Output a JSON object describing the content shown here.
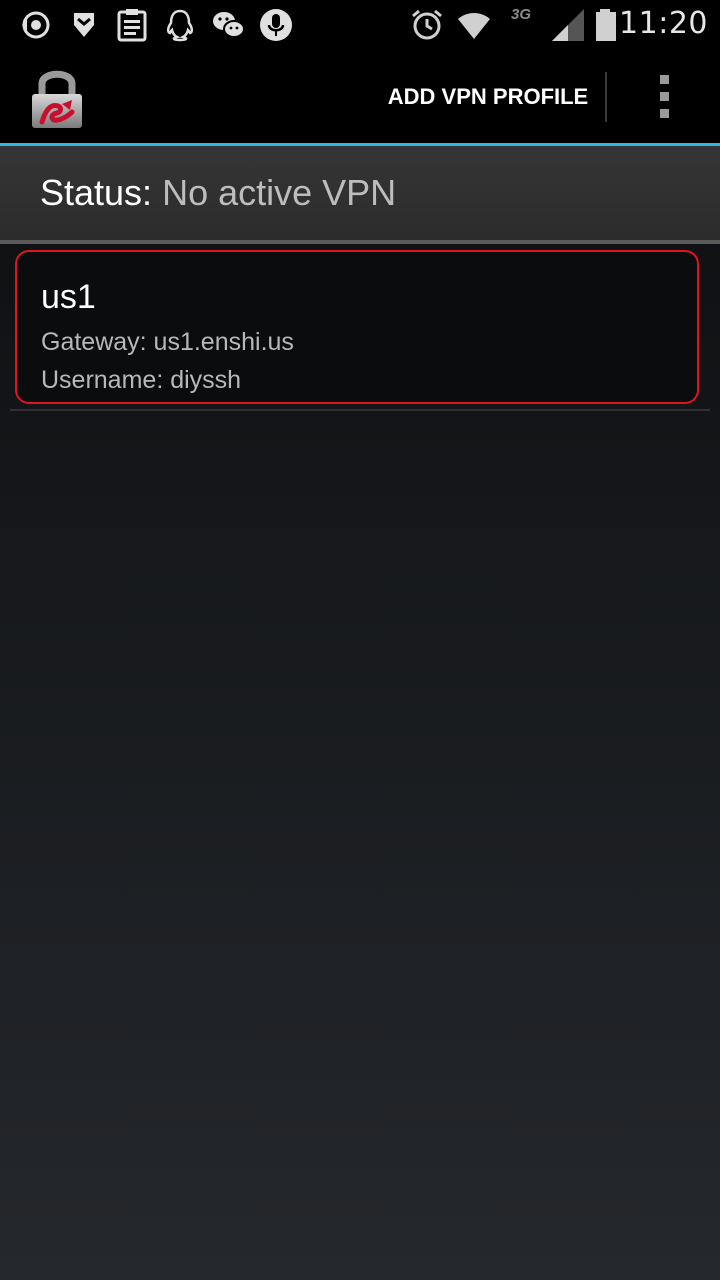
{
  "status_bar": {
    "time": "11:20",
    "network_label": "3G",
    "icons": [
      "sync-icon",
      "shield-icon",
      "clipboard-icon",
      "qq-icon",
      "wechat-icon",
      "microphone-icon",
      "alarm-icon",
      "wifi-icon",
      "signal-icon",
      "battery-icon"
    ]
  },
  "action_bar": {
    "app_icon": "lock-icon",
    "add_profile_label": "ADD VPN PROFILE",
    "overflow_icon": "overflow-menu-icon"
  },
  "status": {
    "label": "Status:",
    "value": "No active VPN"
  },
  "profiles": [
    {
      "name": "us1",
      "gateway": "Gateway: us1.enshi.us",
      "username": "Username: diyssh"
    }
  ],
  "colors": {
    "accent": "#33b5e5",
    "highlight_border": "#e0141e",
    "background_top": "#0c0c0e",
    "background_bottom": "#25282c"
  }
}
